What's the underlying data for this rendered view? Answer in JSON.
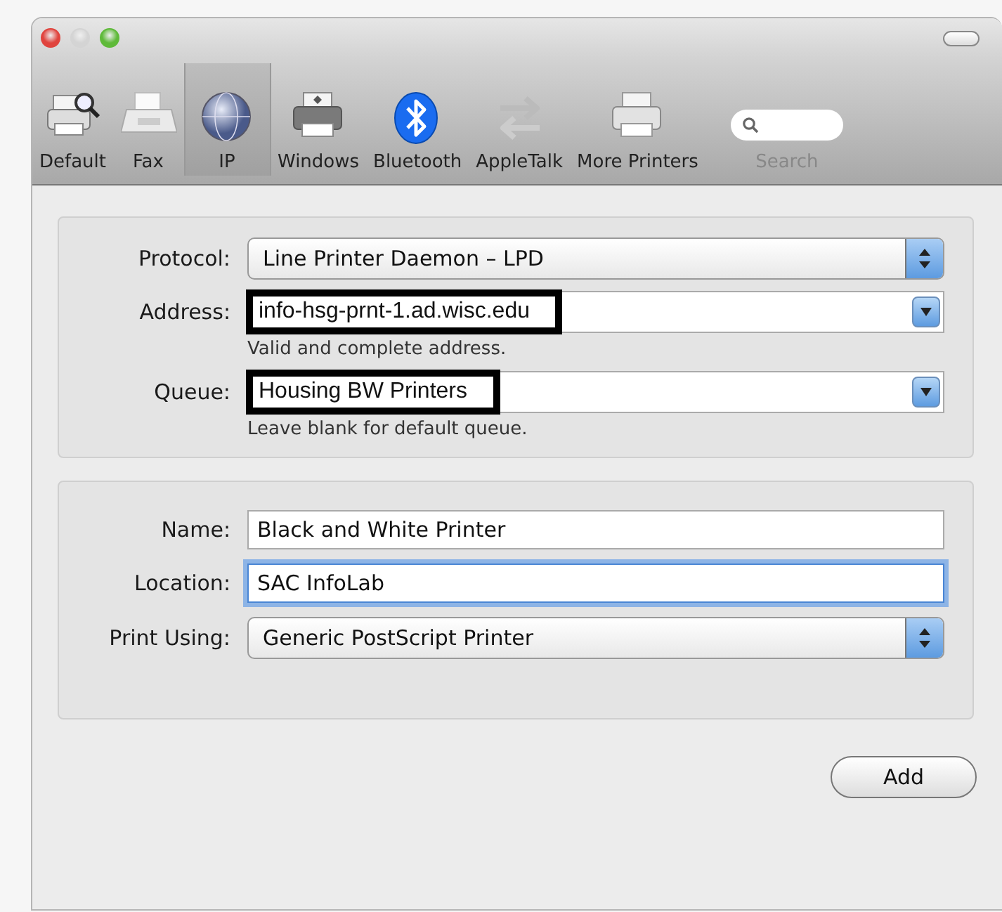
{
  "window": {
    "controls": [
      {
        "color": "#e0443e"
      },
      {
        "color": "#d4d4d4"
      },
      {
        "color": "#5fba3a"
      }
    ]
  },
  "toolbar": {
    "items": [
      {
        "label": "Default",
        "kind": "printer-search",
        "selected": false
      },
      {
        "label": "Fax",
        "kind": "fax",
        "selected": false
      },
      {
        "label": "IP",
        "kind": "globe",
        "selected": true
      },
      {
        "label": "Windows",
        "kind": "printer-dark",
        "selected": false
      },
      {
        "label": "Bluetooth",
        "kind": "bluetooth",
        "selected": false
      },
      {
        "label": "AppleTalk",
        "kind": "arrows",
        "selected": false
      },
      {
        "label": "More Printers",
        "kind": "printer",
        "selected": false
      }
    ],
    "search": {
      "label": "Search"
    }
  },
  "sections": [
    {
      "fields": [
        {
          "label": "Protocol:",
          "kind": "popup",
          "value": "Line Printer Daemon – LPD",
          "highlighted": false,
          "focused": false
        },
        {
          "label": "Address:",
          "kind": "combo",
          "value": "info-hsg-prnt-1.ad.wisc.edu",
          "hint": "Valid and complete address.",
          "highlighted": true,
          "focused": false
        },
        {
          "label": "Queue:",
          "kind": "combo",
          "value": "Housing BW Printers",
          "hint": "Leave blank for default queue.",
          "highlighted": true,
          "focused": false
        }
      ]
    },
    {
      "fields": [
        {
          "label": "Name:",
          "kind": "text",
          "value": "Black and White Printer",
          "highlighted": false,
          "focused": false
        },
        {
          "label": "Location:",
          "kind": "text",
          "value": "SAC InfoLab",
          "highlighted": false,
          "focused": true
        },
        {
          "label": "Print Using:",
          "kind": "popup",
          "value": "Generic PostScript Printer",
          "highlighted": false,
          "focused": false
        }
      ]
    }
  ],
  "buttons": [
    {
      "label": "Add"
    }
  ]
}
